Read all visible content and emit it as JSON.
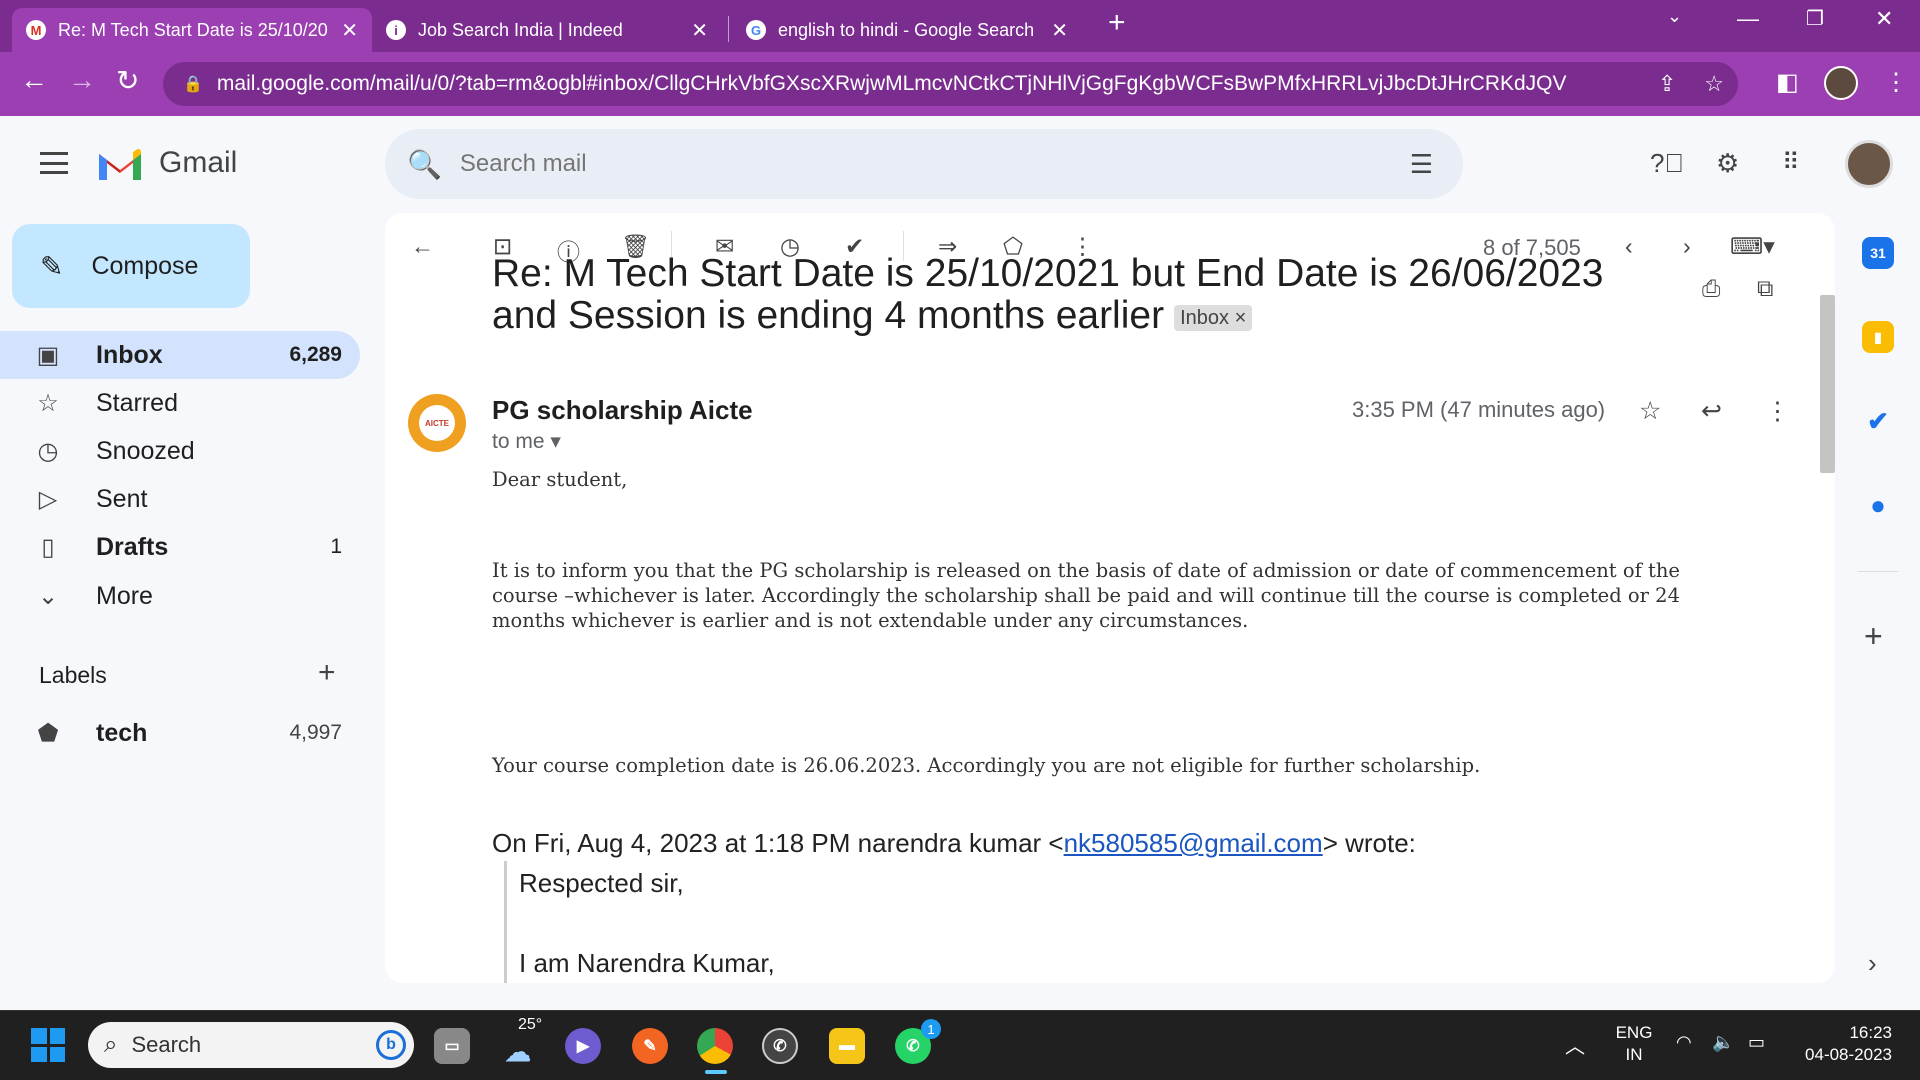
{
  "browser": {
    "tabs": [
      {
        "title": "Re: M Tech Start Date is 25/10/20",
        "favicon": "gmail-icon",
        "active": true
      },
      {
        "title": "Job Search India | Indeed",
        "favicon": "info-icon",
        "active": false
      },
      {
        "title": "english to hindi - Google Search",
        "favicon": "google-icon",
        "active": false
      }
    ],
    "url": "mail.google.com/mail/u/0/?tab=rm&ogbl#inbox/CllgCHrkVbfGXscXRwjwMLmcvNCtkCTjNHlVjGgFgKgbWCFsBwPMfxHRRLvjJbcDtJHrCRKdJQV",
    "accent": "#9b3fb2"
  },
  "gmail": {
    "app_name": "Gmail",
    "search_placeholder": "Search mail",
    "compose_label": "Compose",
    "nav": [
      {
        "label": "Inbox",
        "count": "6,289",
        "icon": "inbox-icon"
      },
      {
        "label": "Starred",
        "count": "",
        "icon": "star-icon"
      },
      {
        "label": "Snoozed",
        "count": "",
        "icon": "clock-icon"
      },
      {
        "label": "Sent",
        "count": "",
        "icon": "send-icon"
      },
      {
        "label": "Drafts",
        "count": "1",
        "icon": "draft-icon"
      },
      {
        "label": "More",
        "count": "",
        "icon": "chevron-down-icon"
      }
    ],
    "labels_heading": "Labels",
    "labels": [
      {
        "label": "tech",
        "count": "4,997"
      }
    ]
  },
  "message": {
    "pager": "8 of 7,505",
    "subject_line1": "Re: M Tech Start Date is 25/10/2021 but End Date is 26/06/2023",
    "subject_line2": "and Session is ending 4 months earlier",
    "badge": "Inbox",
    "badge_close": "×",
    "sender": "PG scholarship Aicte",
    "avatar_text": "AICTE",
    "to": "to me",
    "time": "3:35 PM (47 minutes ago)",
    "greeting": "Dear student,",
    "para1_line1": "It is to inform you that the PG scholarship is released on the basis of date of admission or date of commencement of the",
    "para1_line2": "course –whichever is later. Accordingly the scholarship shall be paid and will continue till the course is completed or 24",
    "para1_line3": "months whichever is earlier and is not extendable under any circumstances.",
    "para2": "Your course completion date is 26.06.2023. Accordingly you are not eligible for further scholarship.",
    "quote_prefix": "On Fri, Aug 4, 2023 at 1:18 PM narendra kumar <",
    "quote_email": "nk580585@gmail.com",
    "quote_suffix": "> wrote:",
    "quote_line1": "Respected sir,",
    "quote_line2": "I am Narendra Kumar,"
  },
  "taskbar": {
    "search_label": "Search",
    "temperature": "25°",
    "lang_line1": "ENG",
    "lang_line2": "IN",
    "time": "16:23",
    "date": "04-08-2023",
    "whatsapp_badge": "1"
  }
}
